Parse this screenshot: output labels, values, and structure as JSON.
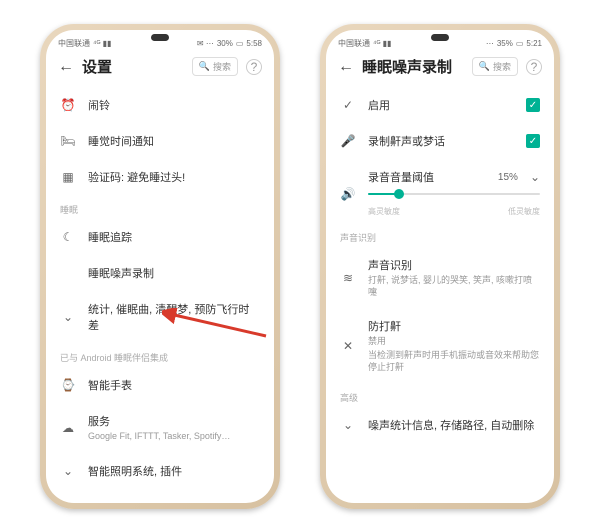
{
  "left": {
    "status": {
      "carrier": "中国联通",
      "battery": "30%",
      "time": "5:58"
    },
    "title": "设置",
    "search_placeholder": "搜索",
    "rows": {
      "alarm": "闹铃",
      "bedtime": "睡觉时间通知",
      "captcha_label": "验证码:",
      "captcha_sub": "避免睡过头!"
    },
    "section_sleep": "睡眠",
    "rows2": {
      "tracking": "睡眠追踪",
      "noise": "睡眠噪声录制",
      "stats": "统计, 催眠曲, 清醒梦, 预防飞行时差"
    },
    "section_android": "已与 Android 睡眠伴侣集成",
    "rows3": {
      "smartwatch": "智能手表",
      "services_label": "服务",
      "services_sub": "Google Fit, IFTTT, Tasker, Spotify…",
      "lighting": "智能照明系统, 插件"
    }
  },
  "right": {
    "status": {
      "carrier": "中国联通",
      "battery": "35%",
      "time": "5:21"
    },
    "title": "睡眠噪声录制",
    "search_placeholder": "搜索",
    "rows": {
      "enable": "启用",
      "snoretalk": "录制鼾声或梦话",
      "threshold_label": "录音音量阈值",
      "threshold_value": "15%",
      "sens_high": "高灵敏度",
      "sens_low": "低灵敏度"
    },
    "section_detect": "声音识别",
    "detect": {
      "label": "声音识别",
      "sub": "打鼾, 说梦话, 婴儿的哭笑, 笑声, 咳嗽打喷嚏"
    },
    "antisnore": {
      "label": "防打鼾",
      "disabled": "禁用",
      "sub": "当检测到鼾声时用手机振动或音效来帮助您停止打鼾"
    },
    "section_adv": "高级",
    "adv": {
      "stats": "噪声统计信息, 存储路径, 自动删除"
    }
  }
}
